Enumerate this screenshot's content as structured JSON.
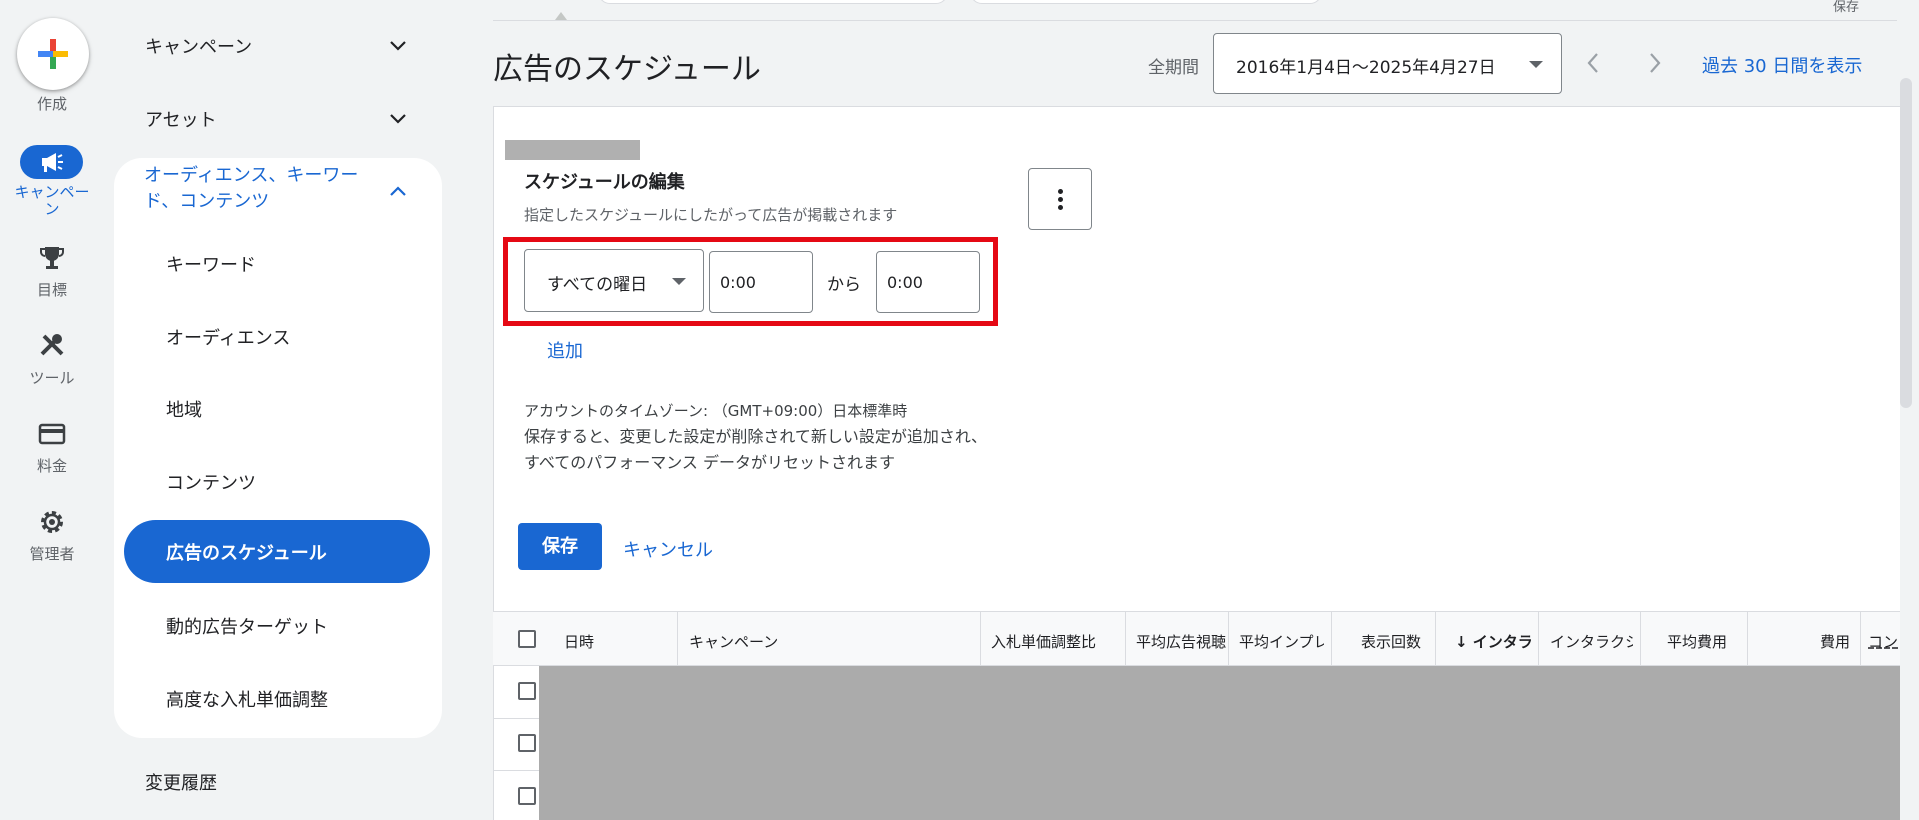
{
  "rail": {
    "create_label": "作成",
    "campaign_label": "キャンペーン",
    "goals_label": "目標",
    "tools_label": "ツール",
    "billing_label": "料金",
    "admin_label": "管理者"
  },
  "sidebar": {
    "campaigns": "キャンペーン",
    "assets": "アセット",
    "audiences_section": "オーディエンス、キーワード、コンテンツ",
    "items": [
      "キーワード",
      "オーディエンス",
      "地域",
      "コンテンツ",
      "広告のスケジュール",
      "動的広告ターゲット",
      "高度な入札単価調整"
    ],
    "change_history": "変更履歴"
  },
  "header": {
    "title": "広告のスケジュール",
    "period_label": "全期間",
    "date_range": "2016年1月4日〜2025年4月27日",
    "show_last_30": "過去 30 日間を表示",
    "top_right": "保存"
  },
  "editor": {
    "title": "スケジュールの編集",
    "description": "指定したスケジュールにしたがって広告が掲載されます",
    "day_value": "すべての曜日",
    "start_time": "0:00",
    "from_label": "から",
    "end_time": "0:00",
    "add_label": "追加",
    "timezone": "アカウントのタイムゾーン: （GMT+09:00）日本標準時",
    "warning_line1": "保存すると、変更した設定が削除されて新しい設定が追加され、",
    "warning_line2": "すべてのパフォーマンス データがリセットされます",
    "save_label": "保存",
    "cancel_label": "キャンセル"
  },
  "table": {
    "columns": [
      "日時",
      "キャンペーン",
      "入札単価調整比",
      "平均広告視聴",
      "平均インプレ",
      "表示回数",
      "↓ インタラ",
      "インタラクシ",
      "平均費用",
      "費用",
      "コン"
    ]
  },
  "colors": {
    "accent": "#1967d2",
    "highlight": "#e50914",
    "background": "#f1f3f4"
  }
}
